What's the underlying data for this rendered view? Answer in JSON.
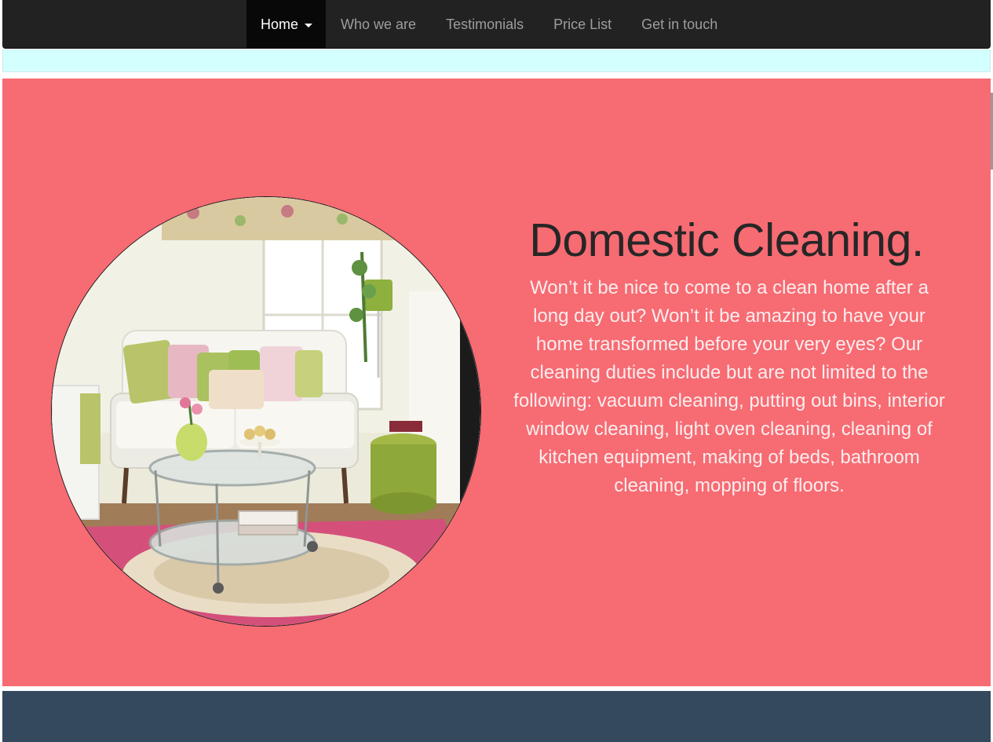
{
  "nav": {
    "items": [
      {
        "label": "Home",
        "active": true,
        "has_dropdown": true
      },
      {
        "label": "Who we are",
        "active": false
      },
      {
        "label": "Testimonials",
        "active": false
      },
      {
        "label": "Price List",
        "active": false
      },
      {
        "label": "Get in touch",
        "active": false
      }
    ]
  },
  "hero": {
    "title": "Domestic Cleaning.",
    "body": "Won’t it be nice to come to a clean home after a long day out? Won’t it be amazing to have your home transformed before your very eyes? Our cleaning duties include but are not limited to the following: vacuum cleaning, putting out bins, interior window cleaning, light oven cleaning, cleaning of kitchen equipment, making of beds, bathroom cleaning, mopping of floors.",
    "image": "living-room-photo"
  },
  "colors": {
    "navbar": "#222222",
    "nav_active": "#080808",
    "nav_text": "#9d9d9d",
    "cyan_band": "#d4ffff",
    "hero_bg": "#f76b73",
    "hero_title": "#262626",
    "hero_text": "#fbeeee",
    "footer_band": "#34495e"
  }
}
